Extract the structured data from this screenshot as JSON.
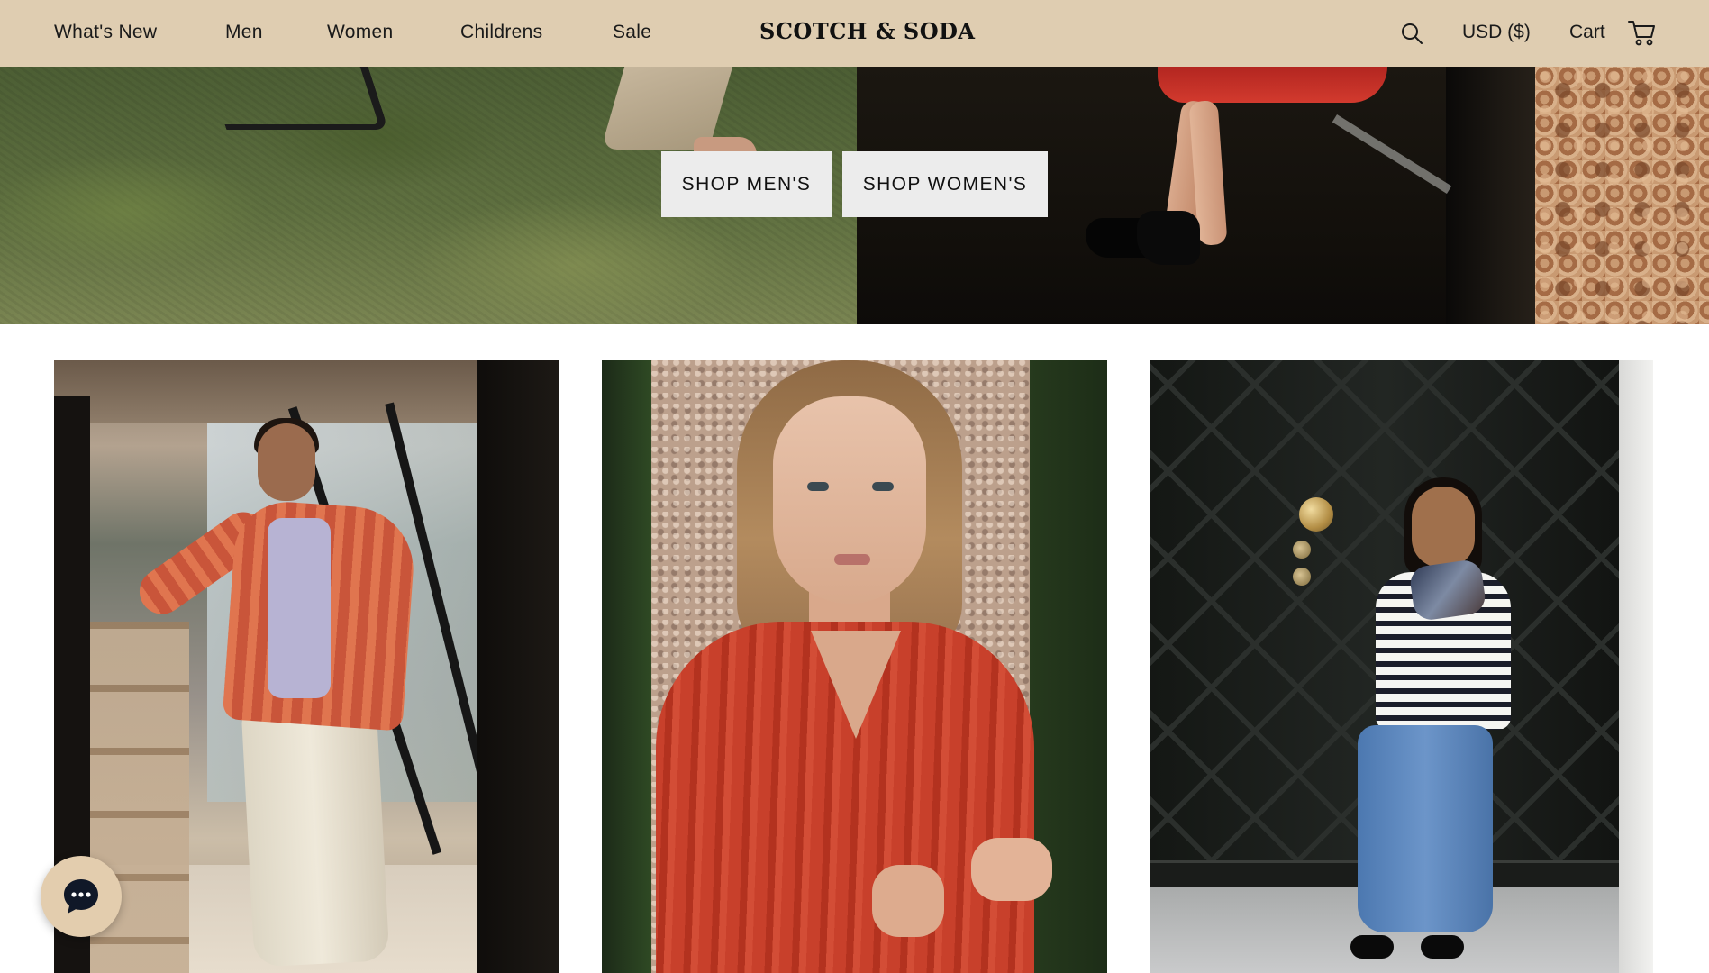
{
  "header": {
    "nav": [
      {
        "label": "What's New"
      },
      {
        "label": "Men"
      },
      {
        "label": "Women"
      },
      {
        "label": "Childrens"
      },
      {
        "label": "Sale"
      }
    ],
    "logo": "SCOTCH & SODA",
    "currency": "USD ($)",
    "cart_label": "Cart",
    "icons": {
      "search": "search-icon",
      "cart": "cart-icon"
    }
  },
  "hero": {
    "buttons": {
      "men": "SHOP MEN'S",
      "women": "SHOP WOMEN'S"
    }
  },
  "chat": {
    "icon": "chat-bubble-icon"
  },
  "colors": {
    "header_bg": "#dfcdb1",
    "button_bg": "#ececec",
    "chat_bg": "#e3cdae",
    "text": "#1a1a1a"
  }
}
